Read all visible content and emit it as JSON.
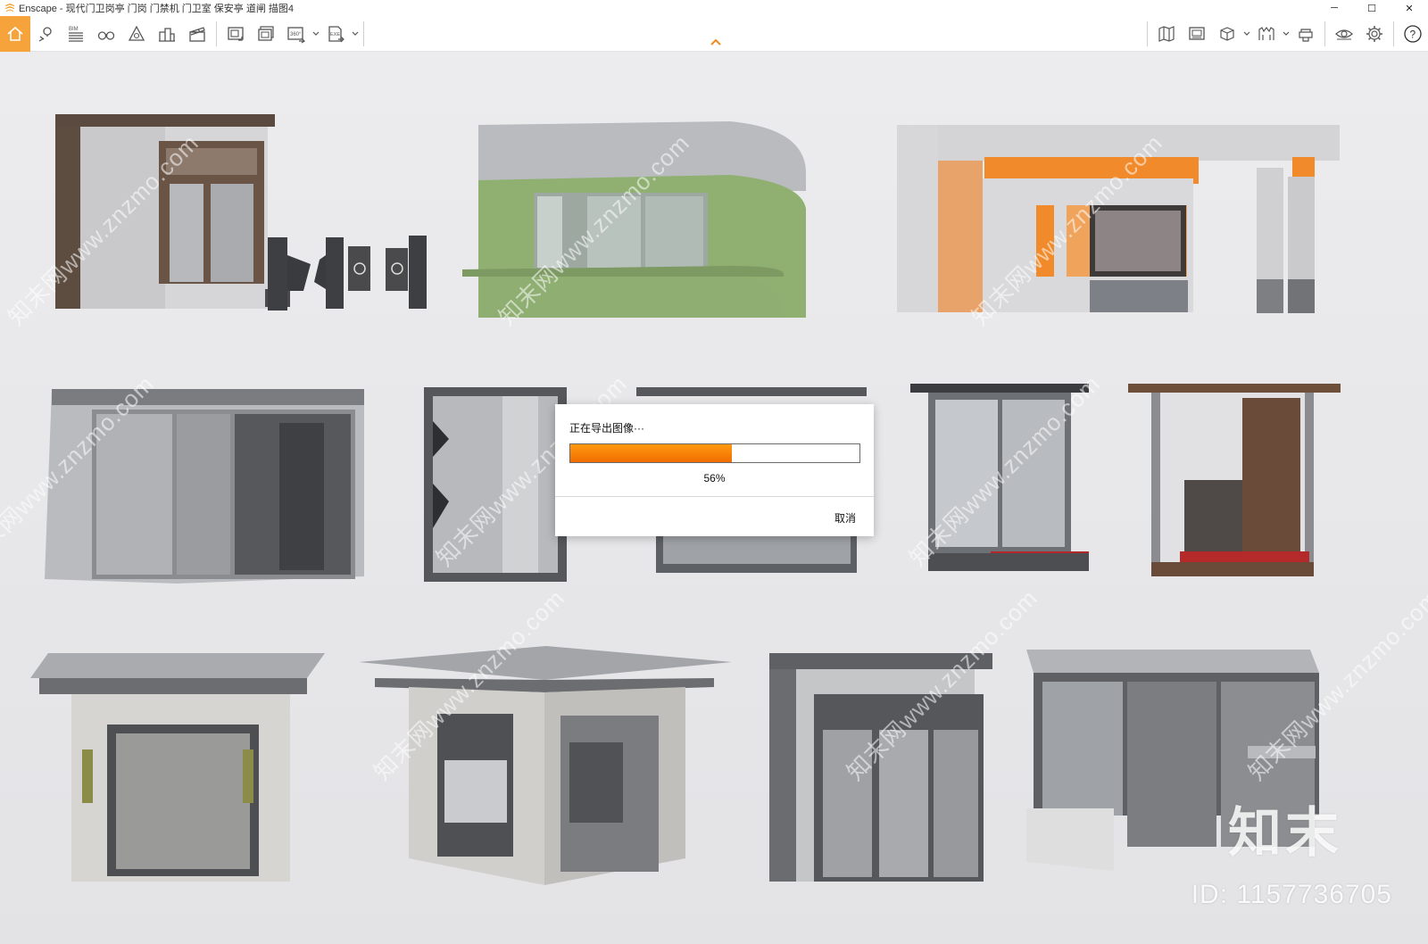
{
  "window": {
    "title": "Enscape - 现代门卫岗亭 门岗 门禁机 门卫室 保安亭 道闸 描图4",
    "minimize": "─",
    "maximize": "☐",
    "close": "✕"
  },
  "toolbar": {
    "left_tools": [
      {
        "name": "home-icon"
      },
      {
        "name": "location-pin-icon"
      },
      {
        "name": "bim-icon",
        "label": "BIM"
      },
      {
        "name": "binoculars-icon"
      },
      {
        "name": "asset-library-icon"
      },
      {
        "name": "buildings-icon"
      },
      {
        "name": "clapperboard-icon"
      },
      {
        "name": "screenshot-icon"
      },
      {
        "name": "batch-render-icon"
      },
      {
        "name": "panorama-360-icon",
        "label": "360°"
      },
      {
        "name": "export-exe-icon",
        "label": "EXE"
      }
    ],
    "right_tools": [
      {
        "name": "map-icon"
      },
      {
        "name": "billboard-icon"
      },
      {
        "name": "cube-icon"
      },
      {
        "name": "material-icon"
      },
      {
        "name": "helmet-icon"
      },
      {
        "name": "eye-icon"
      },
      {
        "name": "settings-gear-icon"
      },
      {
        "name": "help-icon",
        "label": "?"
      }
    ]
  },
  "dialog": {
    "title": "正在导出图像···",
    "progress": 0.56,
    "progress_text": "56%",
    "cancel_label": "取消"
  },
  "watermark": {
    "text": "知末网www.znzmo.com",
    "brand": "知末",
    "id_text": "ID: 1157736705"
  },
  "colors": {
    "accent": "#f5a33a",
    "progress": "#f07a00"
  }
}
